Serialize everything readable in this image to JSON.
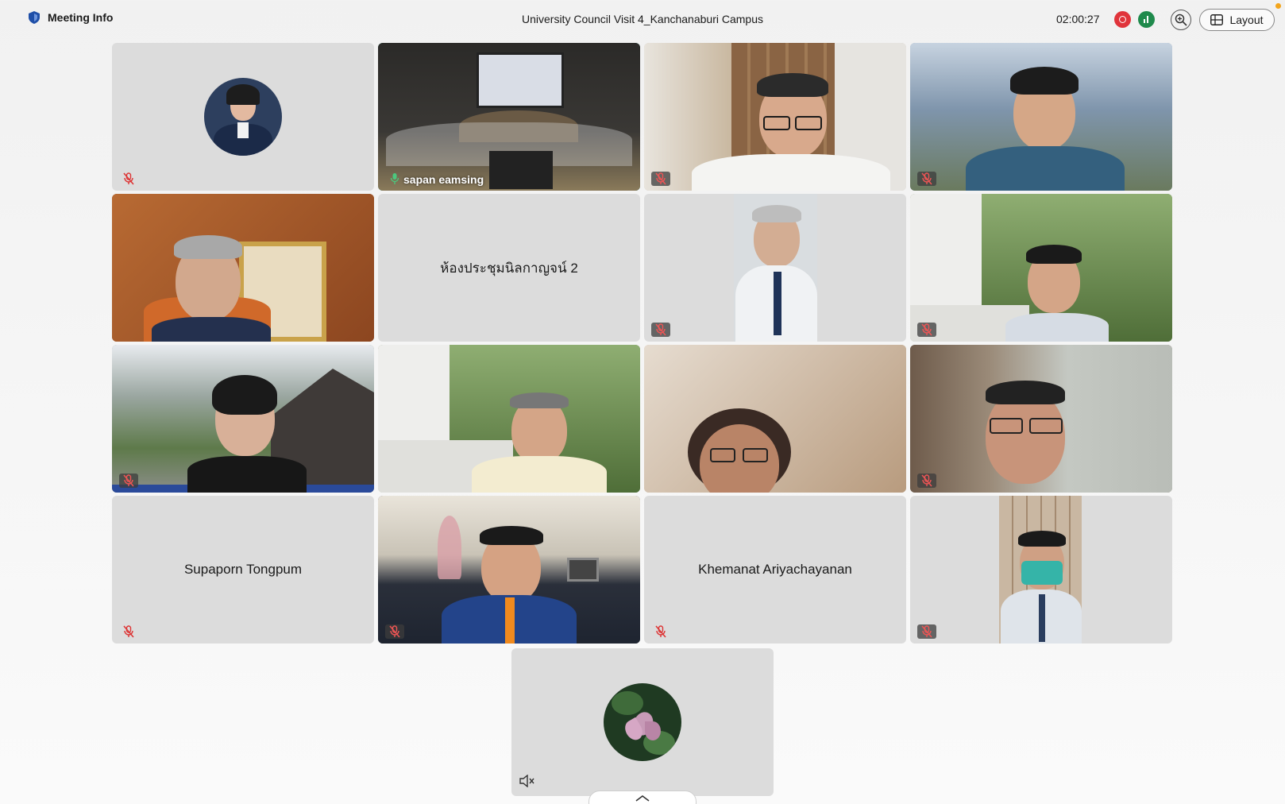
{
  "header": {
    "meeting_info_label": "Meeting Info",
    "meeting_title": "University Council Visit 4_Kanchanaburi Campus",
    "timer": "02:00:27",
    "layout_label": "Layout"
  },
  "colors": {
    "active_speaker_border": "#4cc7b0",
    "record_red": "#e0343b",
    "stats_green": "#1f8a4c",
    "notification_orange": "#f3a51c"
  },
  "tiles": [
    {
      "type": "avatar",
      "muted": true
    },
    {
      "type": "video",
      "name": "sapan eamsing",
      "active": true,
      "mic_on": true
    },
    {
      "type": "video",
      "muted": true
    },
    {
      "type": "video",
      "muted": true
    },
    {
      "type": "video",
      "muted": false
    },
    {
      "type": "name",
      "name": "ห้องประชุมนิลกาญจน์ 2",
      "muted": false
    },
    {
      "type": "video",
      "muted": true
    },
    {
      "type": "video",
      "muted": true
    },
    {
      "type": "video",
      "muted": true
    },
    {
      "type": "video",
      "muted": false
    },
    {
      "type": "video",
      "muted": false
    },
    {
      "type": "video",
      "muted": true
    },
    {
      "type": "name",
      "name": "Supaporn Tongpum",
      "muted": true
    },
    {
      "type": "video",
      "muted": true
    },
    {
      "type": "name",
      "name": "Khemanat Ariyachayanan",
      "muted": true
    },
    {
      "type": "video",
      "muted": true
    }
  ],
  "self_view": {
    "type": "avatar",
    "speaker_muted": true
  }
}
